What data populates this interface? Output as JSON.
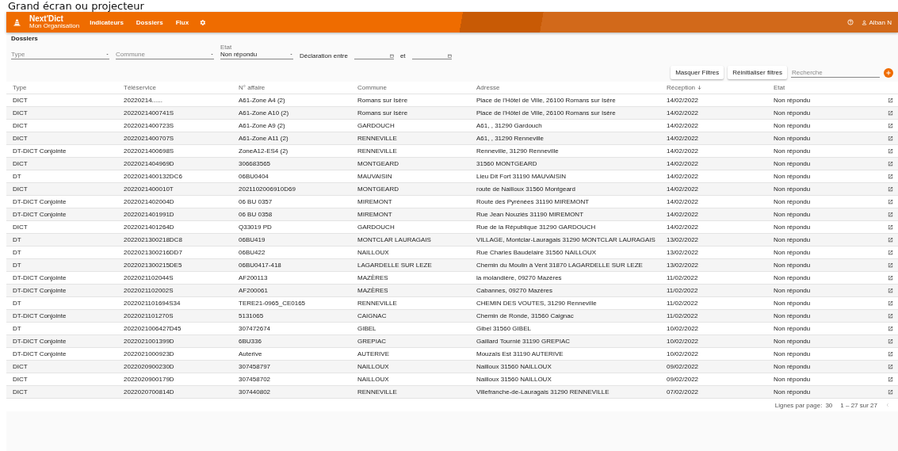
{
  "slide_title": "Grand écran ou projecteur",
  "app_bar": {
    "brand": "Next'Dict",
    "organization": "Mon Organisation",
    "nav": [
      {
        "label": "Indicateurs"
      },
      {
        "label": "Dossiers"
      },
      {
        "label": "Flux"
      }
    ],
    "user": "Alban N"
  },
  "page_title": "Dossiers",
  "filters": {
    "type": {
      "placeholder": "Type"
    },
    "commune": {
      "placeholder": "Commune"
    },
    "etat": {
      "label": "Etat",
      "value": "Non répondu"
    },
    "date_label": "Déclaration entre",
    "date_and": "et"
  },
  "buttons": [
    "Masquer Filtres",
    "Réinitialiser filtres"
  ],
  "search": {
    "placeholder": "Recherche"
  },
  "table": {
    "columns": [
      {
        "label": "Type",
        "sorted": false
      },
      {
        "label": "Téléservice",
        "sorted": false
      },
      {
        "label": "N° affaire",
        "sorted": false
      },
      {
        "label": "Commune",
        "sorted": false
      },
      {
        "label": "Adresse",
        "sorted": false
      },
      {
        "label": "Réception",
        "sorted": true
      },
      {
        "label": "Etat",
        "sorted": false
      }
    ],
    "rows": [
      [
        "DICT",
        "20220214......",
        "A61-Zone A4 (2)",
        "Romans sur Isère",
        "Place de l'Hôtel de Ville, 26100 Romans sur Isère",
        "14/02/2022",
        "Non répondu"
      ],
      [
        "DICT",
        "2022021400741S",
        "A61-Zone A10 (2)",
        "Romans sur Isère",
        "Place de l'Hôtel de Ville, 26100 Romans sur Isère",
        "14/02/2022",
        "Non répondu"
      ],
      [
        "DICT",
        "2022021400723S",
        "A61-Zone A9 (2)",
        "GARDOUCH",
        "A61, , 31290 Gardouch",
        "14/02/2022",
        "Non répondu"
      ],
      [
        "DICT",
        "2022021400707S",
        "A61-Zone A11 (2)",
        "RENNEVILLE",
        "A61, , 31290 Renneville",
        "14/02/2022",
        "Non répondu"
      ],
      [
        "DT-DICT Conjointe",
        "2022021400698S",
        "ZoneA12-ES4 (2)",
        "RENNEVILLE",
        "Renneville, 31290 Renneville",
        "14/02/2022",
        "Non répondu"
      ],
      [
        "DICT",
        "2022021404969D",
        "306683565",
        "MONTGEARD",
        "31560 MONTGEARD",
        "14/02/2022",
        "Non répondu"
      ],
      [
        "DT",
        "2022021400132DC6",
        "06BU0404",
        "MAUVAISIN",
        "Lieu Dit Fort 31190 MAUVAISIN",
        "14/02/2022",
        "Non répondu"
      ],
      [
        "DICT",
        "2022021400010T",
        "2021102006910D69",
        "MONTGEARD",
        "route de Nailloux 31560 Montgeard",
        "14/02/2022",
        "Non répondu"
      ],
      [
        "DT-DICT Conjointe",
        "2022021402004D",
        "06 BU 0357",
        "MIREMONT",
        "Route des Pyrénées 31190 MIREMONT",
        "14/02/2022",
        "Non répondu"
      ],
      [
        "DT-DICT Conjointe",
        "2022021401991D",
        "06 BU 0358",
        "MIREMONT",
        "Rue Jean Nouziès 31190 MIREMONT",
        "14/02/2022",
        "Non répondu"
      ],
      [
        "DICT",
        "2022021401264D",
        "Q33019 PD",
        "GARDOUCH",
        "Rue de la République 31290 GARDOUCH",
        "14/02/2022",
        "Non répondu"
      ],
      [
        "DT",
        "2022021300218DC8",
        "06BU419",
        "MONTCLAR LAURAGAIS",
        "VILLAGE, Montclar-Lauragais 31290 MONTCLAR LAURAGAIS",
        "13/02/2022",
        "Non répondu"
      ],
      [
        "DT",
        "2022021300216DD7",
        "06BU422",
        "NAILLOUX",
        "Rue Charles Baudelaire 31560 NAILLOUX",
        "13/02/2022",
        "Non répondu"
      ],
      [
        "DT",
        "2022021300215DE5",
        "06BU0417-418",
        "LAGARDELLE SUR LEZE",
        "Chemin du Moulin à Vent 31870 LAGARDELLE SUR LEZE",
        "13/02/2022",
        "Non répondu"
      ],
      [
        "DT-DICT Conjointe",
        "2022021102044S",
        "AF200113",
        "MAZÈRES",
        "la molandière, 09270 Mazères",
        "11/02/2022",
        "Non répondu"
      ],
      [
        "DT-DICT Conjointe",
        "2022021102002S",
        "AF200061",
        "MAZÈRES",
        "Cabannes, 09270 Mazères",
        "11/02/2022",
        "Non répondu"
      ],
      [
        "DT",
        "2022021101694S34",
        "TERE21-0965_CE0165",
        "RENNEVILLE",
        "CHEMIN DES VOUTES, 31290 Renneville",
        "11/02/2022",
        "Non répondu"
      ],
      [
        "DT-DICT Conjointe",
        "2022021101270S",
        "5131065",
        "CAIGNAC",
        "Chemin de Ronde, 31560 Caignac",
        "11/02/2022",
        "Non répondu"
      ],
      [
        "DT",
        "2022021006427D45",
        "307472674",
        "GIBEL",
        "Gibel 31560 GIBEL",
        "10/02/2022",
        "Non répondu"
      ],
      [
        "DT-DICT Conjointe",
        "2022021001399D",
        "6BU336",
        "GREPIAC",
        "Gaillard Tournié 31190 GREPIAC",
        "10/02/2022",
        "Non répondu"
      ],
      [
        "DT-DICT Conjointe",
        "2022021000923D",
        "Auterive",
        "AUTERIVE",
        "Mouzaïs Est 31190 AUTERIVE",
        "10/02/2022",
        "Non répondu"
      ],
      [
        "DICT",
        "2022020900230D",
        "307458797",
        "NAILLOUX",
        "Nailloux 31560 NAILLOUX",
        "09/02/2022",
        "Non répondu"
      ],
      [
        "DICT",
        "2022020900179D",
        "307458702",
        "NAILLOUX",
        "Nailloux 31560 NAILLOUX",
        "09/02/2022",
        "Non répondu"
      ],
      [
        "DICT",
        "2022020700814D",
        "307440802",
        "RENNEVILLE",
        "Villefranche-de-Lauragais 31290 RENNEVILLE",
        "07/02/2022",
        "Non répondu"
      ]
    ]
  },
  "pagination": {
    "rows_per_page_label": "Lignes par page:",
    "rows_per_page": "30",
    "range": "1 – 27 sur 27"
  }
}
